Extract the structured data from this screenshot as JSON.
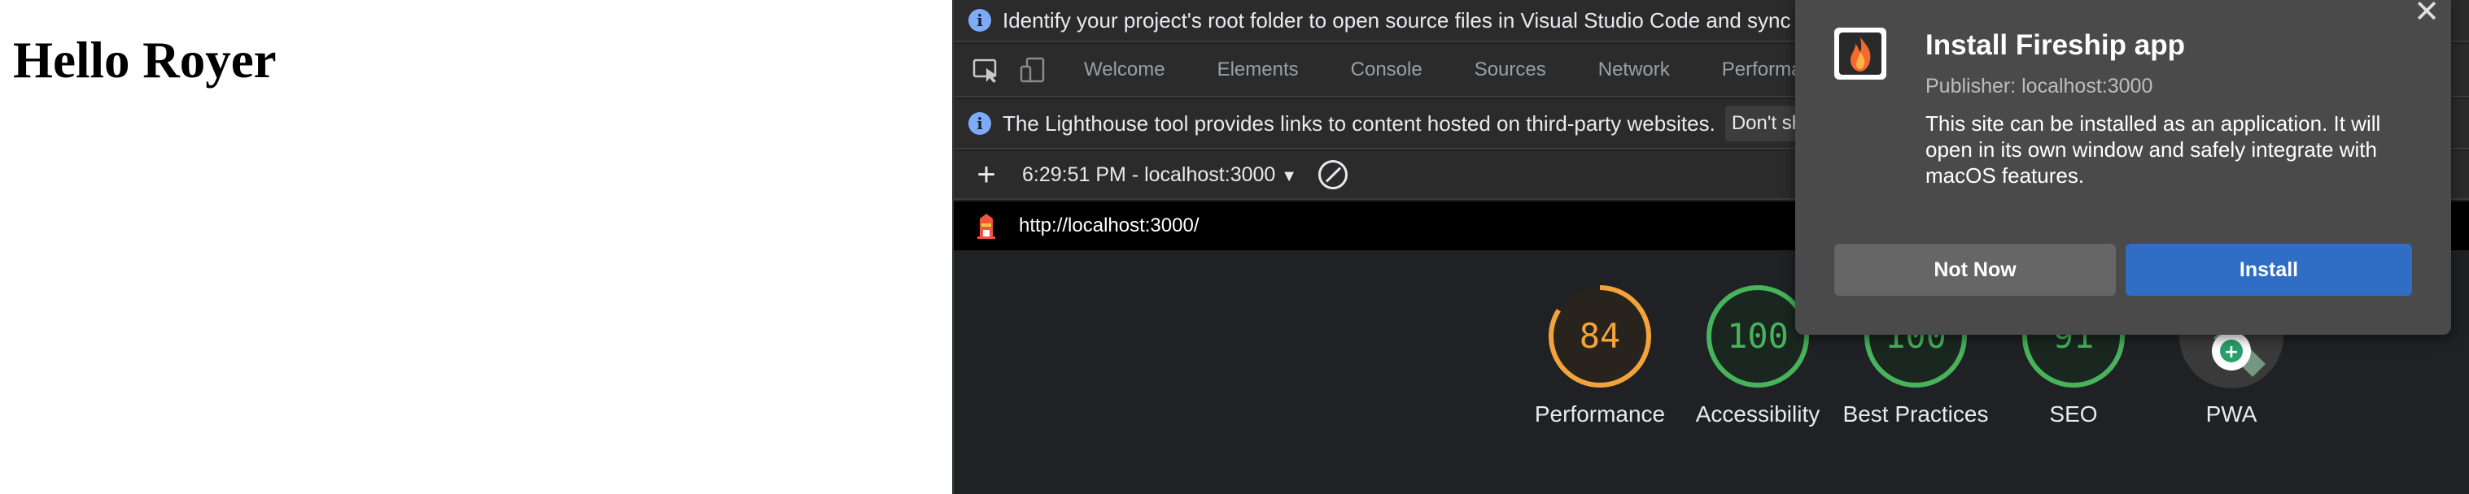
{
  "page": {
    "heading": "Hello Royer"
  },
  "devtools": {
    "info_bar_text": "Identify your project's root folder to open source files in Visual Studio Code and sync chang",
    "tabs": [
      "Welcome",
      "Elements",
      "Console",
      "Sources",
      "Network",
      "Performance"
    ],
    "lighthouse_bar_text": "The Lighthouse tool provides links to content hosted on third-party websites.",
    "dont_show_label": "Don't show a",
    "report_select": "6:29:51 PM - localhost:3000",
    "report_url": "http://localhost:3000/",
    "gauges": [
      {
        "score": "84",
        "label": "Performance",
        "color": "#f4a33b"
      },
      {
        "score": "100",
        "label": "Accessibility",
        "color": "#47b35b"
      },
      {
        "score": "100",
        "label": "Best Practices",
        "color": "#47b35b"
      },
      {
        "score": "91",
        "label": "SEO",
        "color": "#47b35b"
      },
      {
        "score": "",
        "label": "PWA",
        "color": "#5b5b5b"
      }
    ]
  },
  "popup": {
    "title": "Install Fireship app",
    "publisher": "Publisher: localhost:3000",
    "description": "This site can be installed as an application. It will open in its own window and safely integrate with macOS features.",
    "not_now_label": "Not Now",
    "install_label": "Install"
  }
}
